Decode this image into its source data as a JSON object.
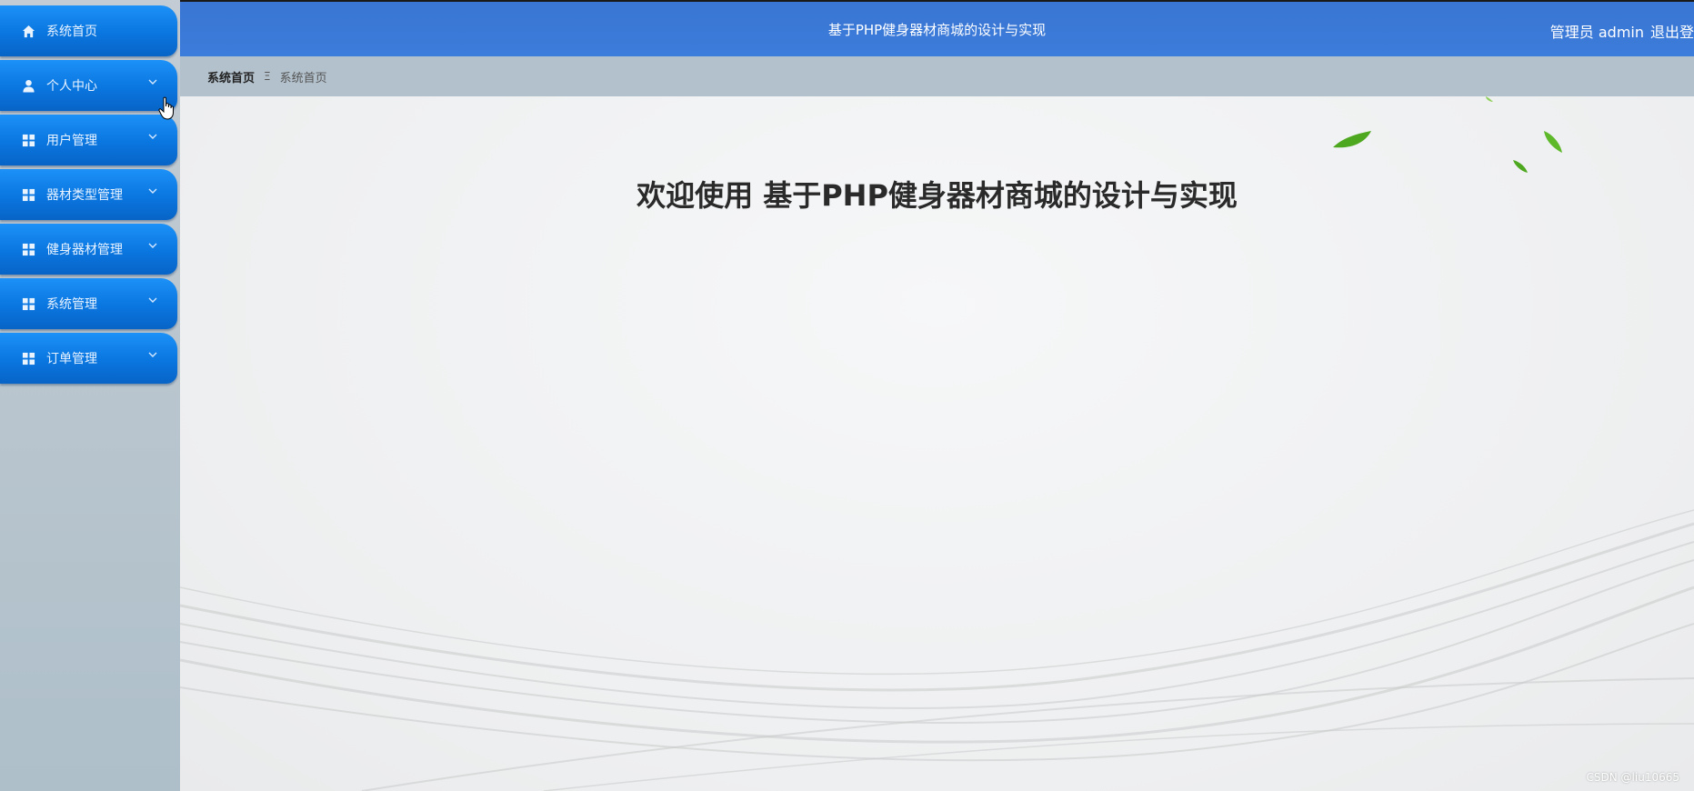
{
  "header": {
    "title": "基于PHP健身器材商城的设计与实现",
    "user_label": "管理员 admin",
    "logout_label": "退出登录"
  },
  "sidebar": {
    "items": [
      {
        "label": "系统首页",
        "icon": "home-icon",
        "has_chevron": false
      },
      {
        "label": "个人中心",
        "icon": "user-icon",
        "has_chevron": true
      },
      {
        "label": "用户管理",
        "icon": "grid-icon",
        "has_chevron": true
      },
      {
        "label": "器材类型管理",
        "icon": "grid-icon",
        "has_chevron": true
      },
      {
        "label": "健身器材管理",
        "icon": "grid-icon",
        "has_chevron": true
      },
      {
        "label": "系统管理",
        "icon": "grid-icon",
        "has_chevron": true
      },
      {
        "label": "订单管理",
        "icon": "grid-icon",
        "has_chevron": true
      }
    ]
  },
  "breadcrumb": {
    "home": "系统首页",
    "separator": "Ξ",
    "current": "系统首页"
  },
  "main": {
    "welcome": "欢迎使用 基于PHP健身器材商城的设计与实现"
  },
  "watermark": "CSDN @liu10665",
  "colors": {
    "header": "#3c7cda",
    "menu": "#0a76e0",
    "sidebar": "#b7c4cd",
    "breadcrumb_bar": "#b3c1cc",
    "leaf": "#5db82a"
  }
}
